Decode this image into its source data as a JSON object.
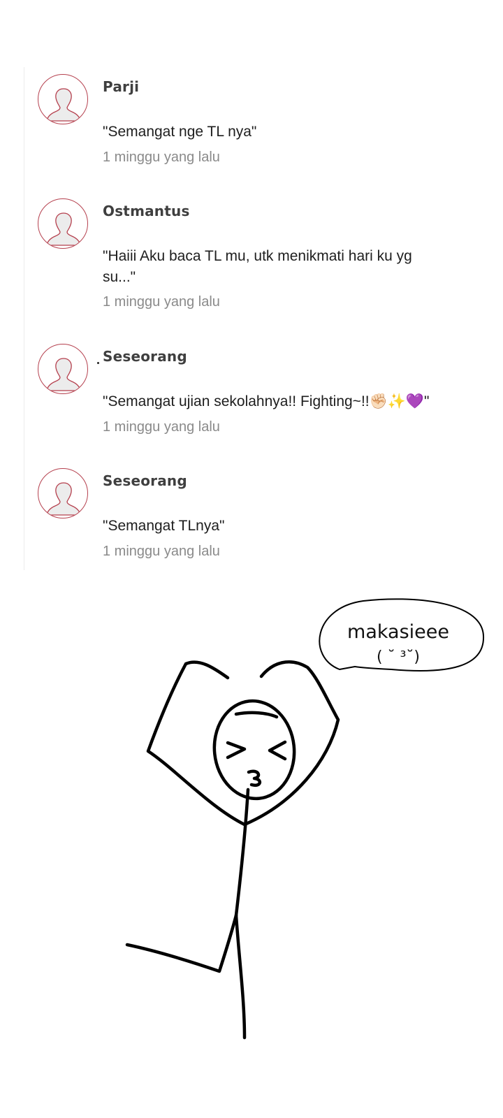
{
  "comments": [
    {
      "author": "Parji",
      "message": "\"Semangat nge TL nya\"",
      "time": "1 minggu yang lalu"
    },
    {
      "author": "Ostmantus",
      "message": "\"Haiii Aku baca TL mu, utk menikmati hari ku yg su...\"",
      "time": "1 minggu yang lalu"
    },
    {
      "author": "Seseorang",
      "message": "\"Semangat ujian sekolahnya!! Fighting~!!✊🏻✨💜\"",
      "time": "1 minggu yang lalu"
    },
    {
      "author": "Seseorang",
      "message": "\"Semangat TLnya\"",
      "time": "1 minggu yang lalu"
    }
  ],
  "drawing": {
    "bubble_text": "makasieee",
    "bubble_face": "( ˘ ³˘)"
  },
  "colors": {
    "avatar_ring": "#b5404e",
    "author": "#3f3f3f",
    "timestamp": "#8a8a8a"
  },
  "icons": {
    "avatar": "default-user-avatar-icon"
  }
}
